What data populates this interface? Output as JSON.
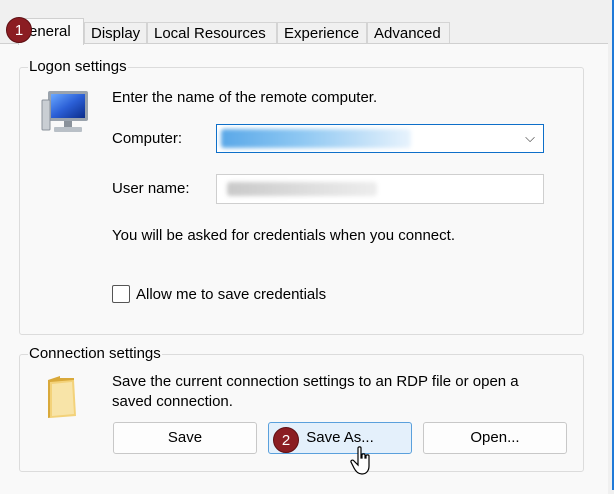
{
  "tabs": [
    {
      "label": "General",
      "shown_label": "eneral",
      "active": true
    },
    {
      "label": "Display"
    },
    {
      "label": "Local Resources"
    },
    {
      "label": "Experience"
    },
    {
      "label": "Advanced"
    }
  ],
  "logon": {
    "legend": "Logon settings",
    "instruction": "Enter the name of the remote computer.",
    "computer_label": "Computer:",
    "username_label": "User name:",
    "credentials_note": "You will be asked for credentials when you connect.",
    "save_credentials_label": "Allow me to save credentials",
    "save_credentials_checked": false
  },
  "connection": {
    "legend": "Connection settings",
    "description_line1": "Save the current connection settings to an RDP file or open a",
    "description_line2": "saved connection.",
    "save_label": "Save",
    "save_as_label": "Save As...",
    "open_label": "Open..."
  },
  "markers": [
    "1",
    "2"
  ],
  "icons": [
    "monitor-icon",
    "folder-icon",
    "chevron-down-icon",
    "mouse-cursor-icon"
  ],
  "colors": {
    "accent": "#0e6fc9",
    "marker": "#8b1d22",
    "hover_button": "#e4f0fb"
  }
}
